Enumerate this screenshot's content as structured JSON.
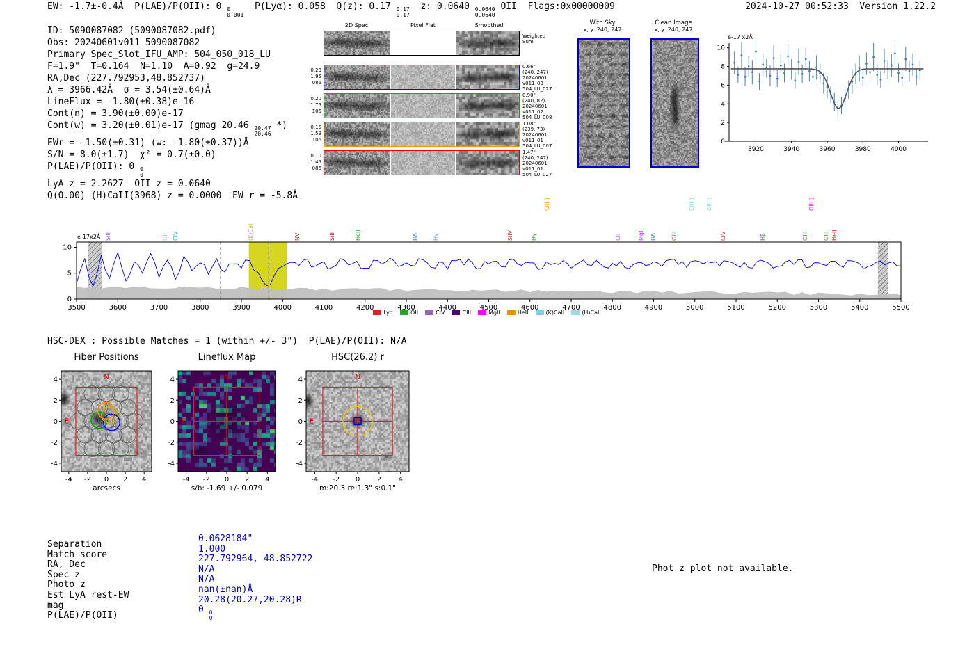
{
  "header": {
    "segments": [
      {
        "t": "EW: -1.7±-0.4Å  P(LAE)/P(OII): 0 "
      },
      {
        "sup": "0",
        "sub": "0.001"
      },
      {
        "t": "  P(Lyα): 0.058  Q(z): 0.17 "
      },
      {
        "sup": "0.17",
        "sub": "0.17"
      },
      {
        "t": "  z: 0.0640 "
      },
      {
        "sup": "0.0640",
        "sub": "0.0640"
      },
      {
        "t": " OII  Flags:0x00000009"
      }
    ],
    "right": "2024-10-27 00:52:33  Version 1.22.2"
  },
  "info_lines": [
    [
      {
        "t": "ID: 5090087082 (5090087082.pdf)"
      }
    ],
    [
      {
        "t": "Obs: 20240601v011_5090087082"
      }
    ],
    [
      {
        "t": "Primary Spec_Slot_IFU_AMP: 504_050_018_LU"
      }
    ],
    [
      {
        "t": "F=1.9\"  T="
      },
      {
        "t": "0.164",
        "over": true
      },
      {
        "t": "  N="
      },
      {
        "t": "1.10",
        "over": true
      },
      {
        "t": "  A="
      },
      {
        "t": "0.92",
        "over": true
      },
      {
        "t": "  g=24."
      },
      {
        "t": "9",
        "over": true
      }
    ],
    [
      {
        "t": "RA,Dec (227.792953,48.852737)"
      }
    ],
    [
      {
        "t": "λ = 3966.42Å  σ = 3.54(±0.64)Å"
      }
    ],
    [
      {
        "t": "LineFlux = -1.80(±0.38)e-16"
      }
    ],
    [
      {
        "t": "Cont(n) = 3.90(±0.00)e-17"
      }
    ],
    [
      {
        "t": "Cont(w) = 3.20(±0.01)e-17 (gmag 20.46 "
      },
      {
        "sup": "20.47",
        "sub": "20.46"
      },
      {
        "t": " *)"
      }
    ],
    [
      {
        "t": "EWr = -1.50(±0.31) (w: -1.80(±0.37))Å"
      }
    ],
    [
      {
        "t": "S/N = 8.0(±1.7)  χ² = 0.7(±0.0)"
      }
    ],
    [
      {
        "t": "P(LAE)/P(OII): 0 "
      },
      {
        "sup": "0",
        "sub": "0"
      }
    ],
    [
      {
        "t": "LyA z = 2.2627  OII z = 0.0640"
      }
    ],
    [
      {
        "t": "Q(0.00) (H)CaII(3968) z = 0.0000  EW r = -5.8Å"
      }
    ]
  ],
  "spec2d": {
    "col_headers": [
      "2D Spec",
      "Pixel Flat",
      "Smoothed"
    ],
    "weighted_label": [
      "Weighted",
      "Sum"
    ],
    "rows": [
      {
        "left": [
          "0.23",
          "1.95",
          "086"
        ],
        "border": "#0000ff",
        "right": [
          "0.66\"",
          "(240, 247)",
          "20240601",
          "v011_03",
          "504_LU_027"
        ]
      },
      {
        "left": [
          "0.20",
          "1.75",
          "105"
        ],
        "border": "#00b300",
        "right": [
          "0.90\"",
          "(240, 82)",
          "20240601",
          "v011_02",
          "504_LU_008"
        ]
      },
      {
        "left": [
          "0.15",
          "1.59",
          "106"
        ],
        "border": "#ff9900",
        "right": [
          "1.08\"",
          "(239, 73)",
          "20240601",
          "v011_01",
          "504_LU_007"
        ]
      },
      {
        "left": [
          "0.10",
          "1.45",
          "086"
        ],
        "border": "#ee0000",
        "right": [
          "1.47\"",
          "(240, 247)",
          "20240601",
          "v011_01",
          "504_LU_027"
        ]
      }
    ]
  },
  "sky_panels": [
    {
      "title": "With Sky",
      "coords": "x, y: 240, 247"
    },
    {
      "title": "Clean Image",
      "coords": "x, y: 240, 247"
    }
  ],
  "chart_data": [
    {
      "name": "line_fit_inset",
      "type": "scatter",
      "corner_label": "e-17 x2Å",
      "x_start": 3908,
      "x_step": 2,
      "values": [
        8.4,
        7.1,
        9.2,
        6.9,
        8.0,
        7.4,
        9.6,
        6.4,
        8.2,
        7.8,
        7.0,
        8.9,
        6.7,
        8.1,
        7.3,
        9.1,
        7.7,
        6.5,
        8.5,
        7.2,
        8.8,
        7.5,
        6.9,
        7.9,
        7.3,
        6.2,
        5.8,
        5.0,
        4.2,
        3.5,
        3.8,
        4.6,
        5.5,
        6.4,
        7.2,
        7.8,
        6.8,
        8.3,
        7.4,
        9.0,
        7.1,
        6.6,
        8.6,
        7.7,
        8.1,
        9.4,
        7.3,
        6.8,
        8.8,
        7.5,
        8.2,
        6.9,
        7.6
      ],
      "errors": [
        1.2,
        0.9,
        1.4,
        1.0,
        1.1,
        1.3,
        1.5,
        0.9,
        1.2,
        1.0,
        1.1,
        1.4,
        0.9,
        1.2,
        1.0,
        1.3,
        1.1,
        0.9,
        1.4,
        1.0,
        1.2,
        1.1,
        0.9,
        1.3,
        1.0,
        1.1,
        1.2,
        0.9,
        1.0,
        1.1,
        0.9,
        1.2,
        1.0,
        1.3,
        1.1,
        1.4,
        0.9,
        1.2,
        1.0,
        1.5,
        1.1,
        0.9,
        1.3,
        1.0,
        1.2,
        1.4,
        1.0,
        0.9,
        1.3,
        1.1,
        1.2,
        0.9,
        1.0
      ],
      "fit": {
        "continuum": 7.75,
        "center": 3966.42,
        "sigma": 4.5,
        "depth": 4.3
      },
      "xticks": [
        3920,
        3940,
        3960,
        3980,
        4000
      ],
      "yticks": [
        0,
        2,
        4,
        6,
        8,
        10
      ],
      "xlim": [
        3905,
        4015
      ],
      "ylim": [
        0,
        10.5
      ],
      "point_color": "#4a7db5",
      "fit_color": "#555555"
    },
    {
      "name": "full_spectrum",
      "type": "line",
      "corner_label": "e-17x2Å",
      "x_start": 3500,
      "x_step": 20,
      "values": [
        3.0,
        7.8,
        2.5,
        8.5,
        4.0,
        9.0,
        3.5,
        7.2,
        5.0,
        8.8,
        4.2,
        7.5,
        3.8,
        8.2,
        5.5,
        7.0,
        4.8,
        7.8,
        5.2,
        6.8,
        6.0,
        7.4,
        5.2,
        2.6,
        4.6,
        6.3,
        7.1,
        6.5,
        7.7,
        6.4,
        7.2,
        6.1,
        7.8,
        6.6,
        7.3,
        6.0,
        7.5,
        6.8,
        7.9,
        6.3,
        7.0,
        6.4,
        7.6,
        6.1,
        7.2,
        5.8,
        7.4,
        6.6,
        7.1,
        5.9,
        6.8,
        7.3,
        6.2,
        7.7,
        6.5,
        7.0,
        5.7,
        7.2,
        6.9,
        7.4,
        6.0,
        7.1,
        6.6,
        7.5,
        6.2,
        6.9,
        7.3,
        5.9,
        7.0,
        6.5,
        7.2,
        6.3,
        7.6,
        6.7,
        6.1,
        7.4,
        6.8,
        7.0,
        6.4,
        7.3,
        6.6,
        7.1,
        6.0,
        7.5,
        6.9,
        6.3,
        7.2,
        6.7,
        7.6,
        6.2,
        7.0,
        6.5,
        7.3,
        6.1,
        7.4,
        6.8,
        6.3,
        7.1,
        6.6,
        7.2,
        6.4
      ],
      "xticks": [
        3500,
        3600,
        3700,
        3800,
        3900,
        4000,
        4100,
        4200,
        4300,
        4400,
        4500,
        4600,
        4700,
        4800,
        4900,
        5000,
        5100,
        5200,
        5300,
        5400,
        5500
      ],
      "yticks": [
        0,
        5,
        10
      ],
      "xlim": [
        3500,
        5500
      ],
      "ylim": [
        0,
        11
      ],
      "line_color": "#0000ee",
      "error_band": {
        "start": 2.4,
        "end": 0.9,
        "color": "#c0c0c0"
      },
      "highlight_band": {
        "x0": 3918,
        "x1": 4010,
        "color": "#d2d20a"
      },
      "hatched_bands": [
        [
          3528,
          3562
        ],
        [
          5444,
          5468
        ]
      ],
      "dashed_lines": [
        {
          "x": 3849,
          "color": "#999999"
        },
        {
          "x": 3966.4,
          "color": "#333333"
        }
      ]
    }
  ],
  "spectral_lines": [
    {
      "label": "SiII",
      "wl": 3585,
      "color": "#9467bd"
    },
    {
      "label": "OII",
      "wl": 3722,
      "color": "#87cefa"
    },
    {
      "label": "CIV",
      "wl": 3748,
      "color": "#17becf"
    },
    {
      "label": "(K)CaII",
      "wl": 3930,
      "color": "#bcbd22"
    },
    {
      "label": "NV",
      "wl": 4044,
      "color": "#d62728"
    },
    {
      "label": "SiII",
      "wl": 4128,
      "color": "#a02c2c"
    },
    {
      "label": "HeII",
      "wl": 4190,
      "color": "#2ca02c"
    },
    {
      "label": "Hδ",
      "wl": 4330,
      "color": "#1f77b4"
    },
    {
      "label": "Hγ",
      "wl": 4380,
      "color": "#6baed6"
    },
    {
      "label": "SiIV",
      "wl": 4560,
      "color": "#c23b22"
    },
    {
      "label": "Hγ",
      "wl": 4618,
      "color": "#2ca02c"
    },
    {
      "label": "CIII ]",
      "wl": 4650,
      "color": "#ff8c00",
      "raised": true
    },
    {
      "label": "CII",
      "wl": 4822,
      "color": "#9467bd"
    },
    {
      "label": "MgII",
      "wl": 4878,
      "color": "#ff00ff"
    },
    {
      "label": "Hδ",
      "wl": 4908,
      "color": "#1f77b4"
    },
    {
      "label": "OIII",
      "wl": 4959,
      "color": "#2ca02c"
    },
    {
      "label": "CIII ]",
      "wl": 5000,
      "color": "#87cefa",
      "raised": true
    },
    {
      "label": "OIII ]",
      "wl": 5042,
      "color": "#87cefa",
      "raised": true
    },
    {
      "label": "CIV",
      "wl": 5076,
      "color": "#d62728"
    },
    {
      "label": "Hβ",
      "wl": 5172,
      "color": "#2ca02c"
    },
    {
      "label": "OIII",
      "wl": 5276,
      "color": "#2ca02c"
    },
    {
      "label": "OIII ]",
      "wl": 5290,
      "color": "#ff00ff",
      "raised": true
    },
    {
      "label": "OIII",
      "wl": 5327,
      "color": "#2ca02c"
    },
    {
      "label": "HeII",
      "wl": 5347,
      "color": "#d62728"
    }
  ],
  "legend": [
    {
      "label": "Lyα",
      "color": "#d62728"
    },
    {
      "label": "OII",
      "color": "#2ca02c"
    },
    {
      "label": "CIV",
      "color": "#9467bd"
    },
    {
      "label": "CIII",
      "color": "#4b0082"
    },
    {
      "label": "MgII",
      "color": "#ff00ff"
    },
    {
      "label": "HeII",
      "color": "#ff8c00"
    },
    {
      "label": "(K)CaII",
      "color": "#87ceeb"
    },
    {
      "label": "(H)CaII",
      "color": "#9edae5"
    }
  ],
  "hsc_dex_line": "HSC-DEX : Possible Matches = 1 (within +/- 3\")  P(LAE)/P(OII): N/A",
  "cutouts": [
    {
      "title": "Fiber Positions",
      "xlabel": "arcsecs",
      "ticks": [
        -4,
        -2,
        0,
        2,
        4
      ],
      "compass": {
        "n": "N",
        "e": "E"
      },
      "type": "fibers"
    },
    {
      "title": "Lineflux Map",
      "xlabel": "s/b: -1.69 +/- 0.079",
      "ticks": [
        -4,
        -2,
        0,
        2,
        4
      ],
      "compass": {
        "n": "N",
        "e": "E"
      },
      "type": "lineflux"
    },
    {
      "title": "HSC(26.2) r",
      "xlabel": "m:20.3 re:1.3\" s:0.1\"",
      "ticks": [
        -4,
        -2,
        0,
        2,
        4
      ],
      "compass": {
        "n": "N",
        "e": "E"
      },
      "type": "hsc"
    }
  ],
  "match_table": [
    {
      "label": "Separation",
      "value": "0.0628184\""
    },
    {
      "label": "Match score",
      "value": "1.000"
    },
    {
      "label": "RA, Dec",
      "value": "227.792964, 48.852722"
    },
    {
      "label": "Spec z",
      "value": "N/A"
    },
    {
      "label": "Photo z",
      "value": "N/A"
    },
    {
      "label": "Est LyA rest-EW",
      "value": "nan(±nan)Å"
    },
    {
      "label": "mag",
      "value": "20.28(20.27,20.28)R"
    },
    {
      "label": "P(LAE)/P(OII)",
      "value": "0",
      "sup": "0",
      "sub": "0"
    }
  ],
  "photz_note": "Phot z plot not available.",
  "colors": {
    "value_blue": "#0000cc",
    "panel_border_blue": "#0000cc",
    "compass_red": "#e00000",
    "square_red": "#e02020",
    "fiber_gray": "#5a5a5a",
    "yellow_circle": "#e6c619"
  }
}
